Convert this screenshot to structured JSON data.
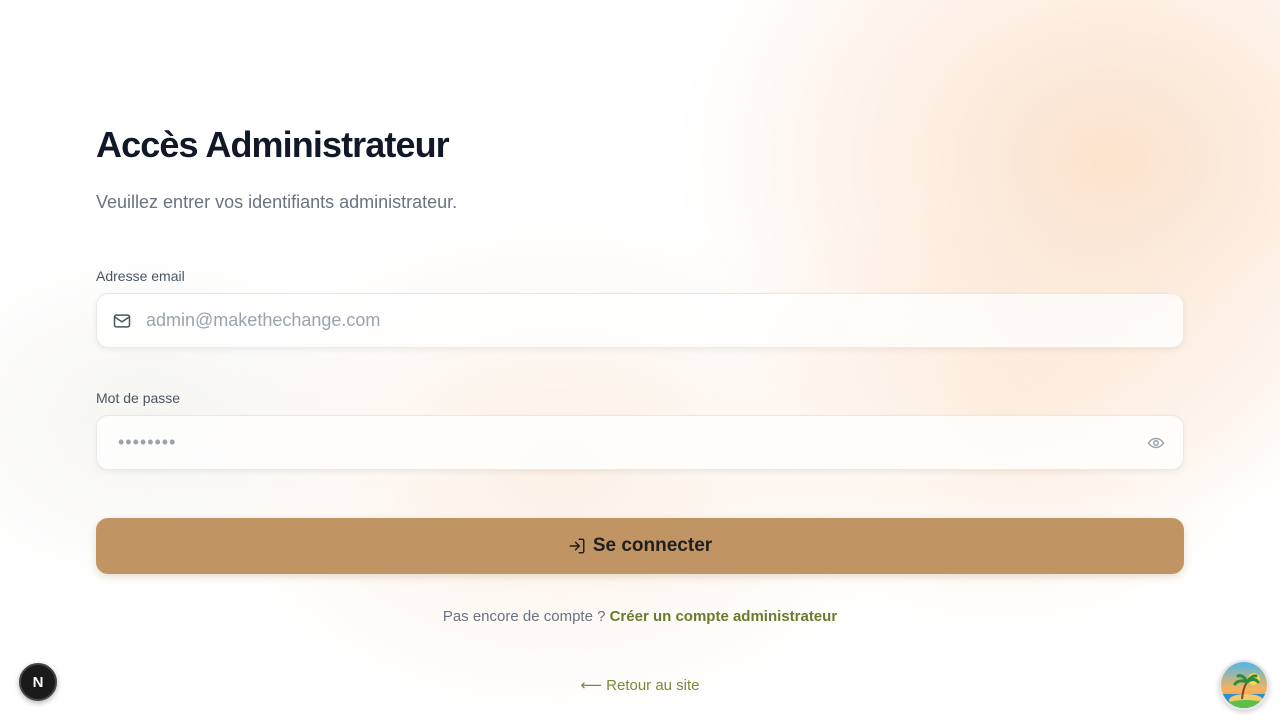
{
  "login": {
    "title": "Accès Administrateur",
    "subtitle": "Veuillez entrer vos identifiants administrateur.",
    "email_label": "Adresse email",
    "email_placeholder": "admin@makethechange.com",
    "password_label": "Mot de passe",
    "password_placeholder": "••••••••",
    "submit_label": "Se connecter",
    "signup_prompt": "Pas encore de compte ? ",
    "signup_link": "Créer un compte administrateur",
    "back_link": "⟵ Retour au site"
  },
  "dev_badge": {
    "letter": "N"
  },
  "icons": {
    "email": "mail-icon",
    "password_toggle": "eye-icon",
    "submit": "login-icon",
    "avatar": "island-avatar"
  },
  "colors": {
    "primary_button": "#c19563",
    "link": "#6b7b2e",
    "title": "#111827",
    "muted": "#6b7280"
  }
}
